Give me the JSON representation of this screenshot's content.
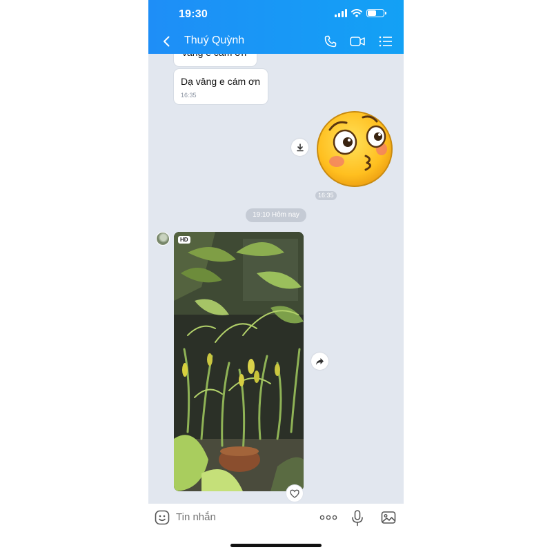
{
  "status_bar": {
    "time": "19:30"
  },
  "header": {
    "contact_name": "Thuý Quỳnh"
  },
  "messages": {
    "partial_text": "vâng e cám ơn",
    "incoming_text": "Dạ vâng e cám ơn",
    "incoming_time": "16:35",
    "sticker_time": "16:35",
    "date_separator": "19:10 Hôm nay",
    "photo_badge": "HD"
  },
  "composer": {
    "placeholder": "Tin nhắn"
  },
  "colors": {
    "header": "#1e8ef7",
    "chat_background": "#e2e7ef"
  },
  "icons": [
    "back-icon",
    "phone-icon",
    "video-call-icon",
    "menu-list-icon",
    "download-icon",
    "share-icon",
    "heart-icon",
    "emoji-icon",
    "more-icon",
    "mic-icon",
    "gallery-icon"
  ]
}
